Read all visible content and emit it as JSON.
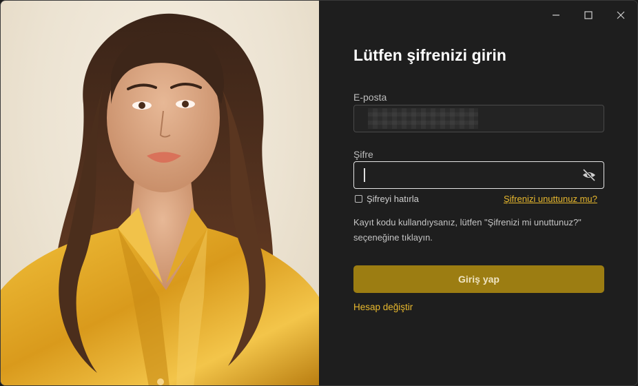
{
  "window": {
    "controls": {
      "minimize_icon": "minimize-icon",
      "maximize_icon": "maximize-icon",
      "close_icon": "close-icon"
    }
  },
  "photo": {
    "subject": "portrait"
  },
  "login": {
    "title": "Lütfen şifrenizi girin",
    "email_label": "E-posta",
    "password_label": "Şifre",
    "remember_label": "Şifreyi hatırla",
    "forgot_link": "Şifrenizi unuttunuz mu?",
    "note": "Kayıt kodu kullandıysanız, lütfen \"Şifrenizi mi unuttunuz?\" seçeneğine tıklayın.",
    "login_button": "Giriş yap",
    "switch_account": "Hesap değiştir"
  },
  "colors": {
    "accent": "#e9b92e",
    "button": "#9c7d12",
    "background": "#1e1e1e"
  }
}
